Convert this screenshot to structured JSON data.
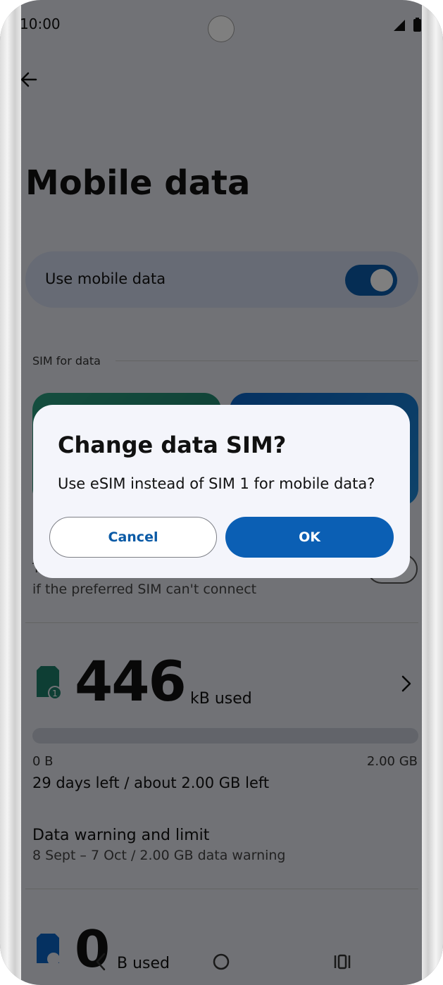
{
  "status_bar": {
    "time": "10:00",
    "signal_icon": "cellular-signal-icon",
    "battery_icon": "battery-icon"
  },
  "page": {
    "title": "Mobile data",
    "back_icon": "arrow-left-icon"
  },
  "mobile_data_toggle": {
    "label": "Use mobile data",
    "enabled": true
  },
  "sim_section": {
    "label": "SIM for data"
  },
  "secondary": {
    "line1": "T",
    "line2": "if the preferred SIM can't connect"
  },
  "usage": {
    "amount": "446",
    "unit": "kB used",
    "range_min": "0 B",
    "range_max": "2.00 GB",
    "days_left": "29 days left / about 2.00 GB left"
  },
  "warning": {
    "title": "Data warning and limit",
    "subtitle": "8 Sept – 7 Oct / 2.00 GB data warning"
  },
  "usage2": {
    "amount": "0",
    "unit": "B used"
  },
  "dialog": {
    "title": "Change data SIM?",
    "message": "Use eSIM instead of SIM 1 for mobile data?",
    "cancel_label": "Cancel",
    "ok_label": "OK"
  },
  "colors": {
    "primary": "#0b5fb4",
    "sim1": "#1d7c68",
    "esim": "#0b63c3"
  }
}
